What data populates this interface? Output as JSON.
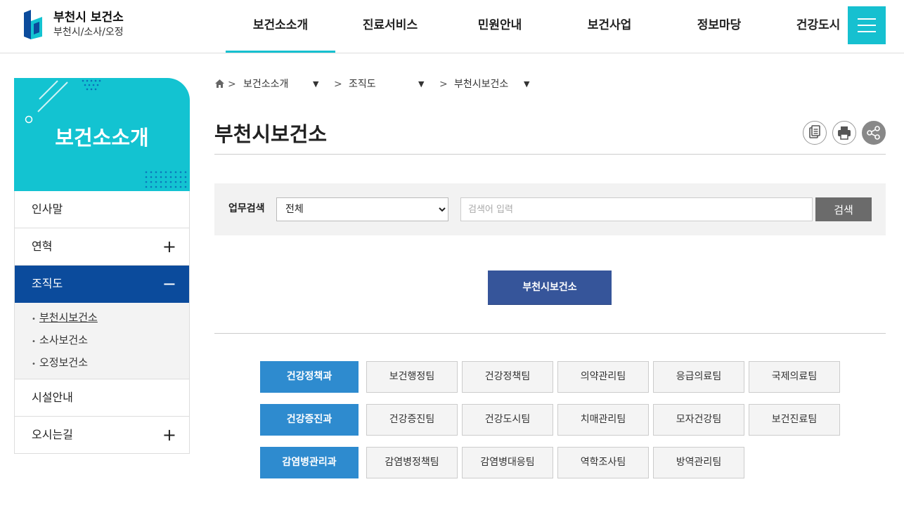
{
  "header": {
    "logo_title": "부천시 보건소",
    "logo_sub": "부천시/소사/오정",
    "nav": [
      "보건소소개",
      "진료서비스",
      "민원안내",
      "보건사업",
      "정보마당",
      "건강도시"
    ],
    "accent_color": "#16c0d0"
  },
  "sidebar": {
    "title": "보건소소개",
    "items": [
      {
        "label": "인사말",
        "toggle": ""
      },
      {
        "label": "연혁",
        "toggle": "+"
      },
      {
        "label": "조직도",
        "toggle": "−"
      },
      {
        "label": "시설안내",
        "toggle": ""
      },
      {
        "label": "오시는길",
        "toggle": "+"
      }
    ],
    "sub_items": [
      "부천시보건소",
      "소사보건소",
      "오정보건소"
    ],
    "sub_bullet": "•",
    "active_color": "#0b4b9c"
  },
  "breadcrumb": {
    "sep": ">",
    "items": [
      "보건소소개",
      "조직도",
      "부천시보건소"
    ]
  },
  "page": {
    "title": "부천시보건소"
  },
  "search": {
    "label": "업무검색",
    "select_value": "전체",
    "placeholder": "검색어 입력",
    "button": "검색"
  },
  "org": {
    "root": "부천시보건소",
    "rows": [
      {
        "dept": "건강정책과",
        "teams": [
          "보건행정팀",
          "건강정책팀",
          "의약관리팀",
          "응급의료팀",
          "국제의료팀"
        ]
      },
      {
        "dept": "건강증진과",
        "teams": [
          "건강증진팀",
          "건강도시팀",
          "치매관리팀",
          "모자건강팀",
          "보건진료팀"
        ]
      },
      {
        "dept": "감염병관리과",
        "teams": [
          "감염병정책팀",
          "감염병대응팀",
          "역학조사팀",
          "방역관리팀"
        ]
      }
    ],
    "root_color": "#36559a",
    "dept_color": "#2e8bcf"
  }
}
